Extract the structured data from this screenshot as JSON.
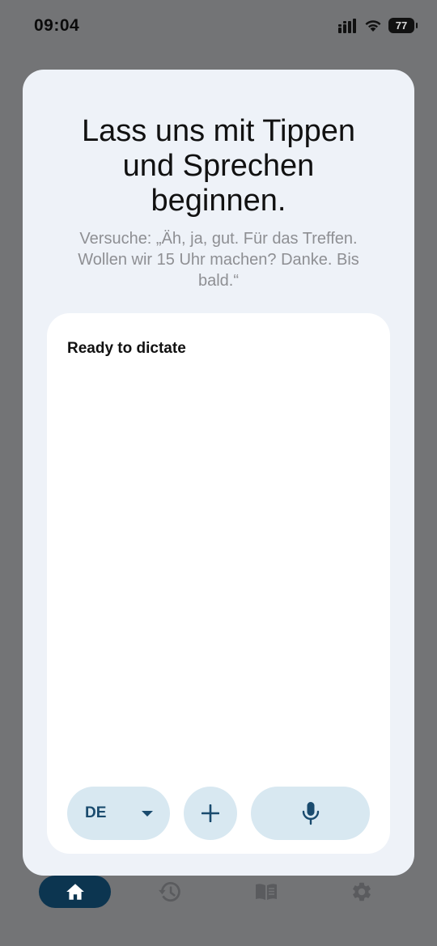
{
  "status_bar": {
    "time": "09:04",
    "battery": "77"
  },
  "onboarding": {
    "title_line1": "Lass uns mit Tippen",
    "title_line2": "und Sprechen",
    "title_line3": "beginnen.",
    "subtitle": "Versuche: „Äh, ja, gut. Für das Treffen. Wollen wir 15 Uhr machen? Danke. Bis bald.“"
  },
  "dictation": {
    "status": "Ready to dictate",
    "language": "DE"
  },
  "nav": {
    "items": [
      {
        "icon": "home-icon",
        "active": true
      },
      {
        "icon": "history-icon",
        "active": false
      },
      {
        "icon": "book-icon",
        "active": false
      },
      {
        "icon": "gear-icon",
        "active": false
      }
    ]
  },
  "colors": {
    "accent": "#1a4b6e",
    "button_bg": "#d8e8f1",
    "nav_active": "#0c3550",
    "modal_bg": "#eef2f8",
    "overlay": "#737476"
  }
}
